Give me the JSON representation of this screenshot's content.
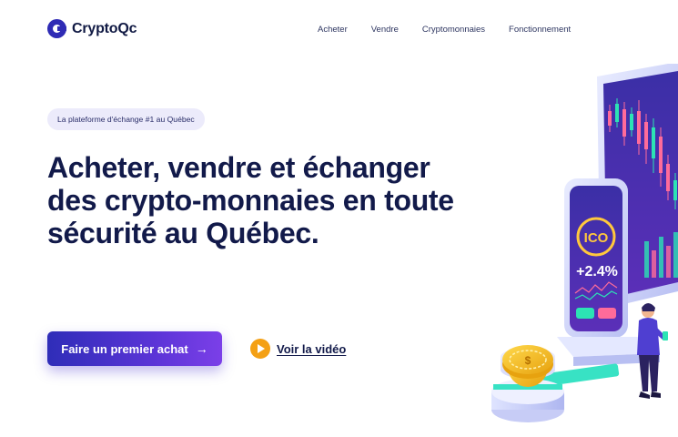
{
  "brand": {
    "name": "CryptoQc"
  },
  "nav": {
    "items": [
      {
        "label": "Acheter"
      },
      {
        "label": "Vendre"
      },
      {
        "label": "Cryptomonnaies"
      },
      {
        "label": "Fonctionnement"
      }
    ]
  },
  "hero": {
    "badge": "La plateforme d'échange #1 au Québec",
    "headline_lines": [
      "Acheter, vendre et échanger",
      "des crypto-monnaies en toute",
      "sécurité au Québec."
    ],
    "cta_label": "Faire un premier achat",
    "cta_icon": "arrow-right-icon",
    "video_label": "Voir la vidéo",
    "video_icon": "play-icon"
  },
  "illustration": {
    "phone_badge": "ICO",
    "phone_change": "+2.4%",
    "coin_symbol": "$"
  },
  "colors": {
    "brand": "#2f2bb5",
    "cta_start": "#2f2db8",
    "cta_end": "#7b3fe8",
    "play": "#f4a014",
    "badge_bg": "#ecebfb",
    "headline": "#121a4a"
  }
}
